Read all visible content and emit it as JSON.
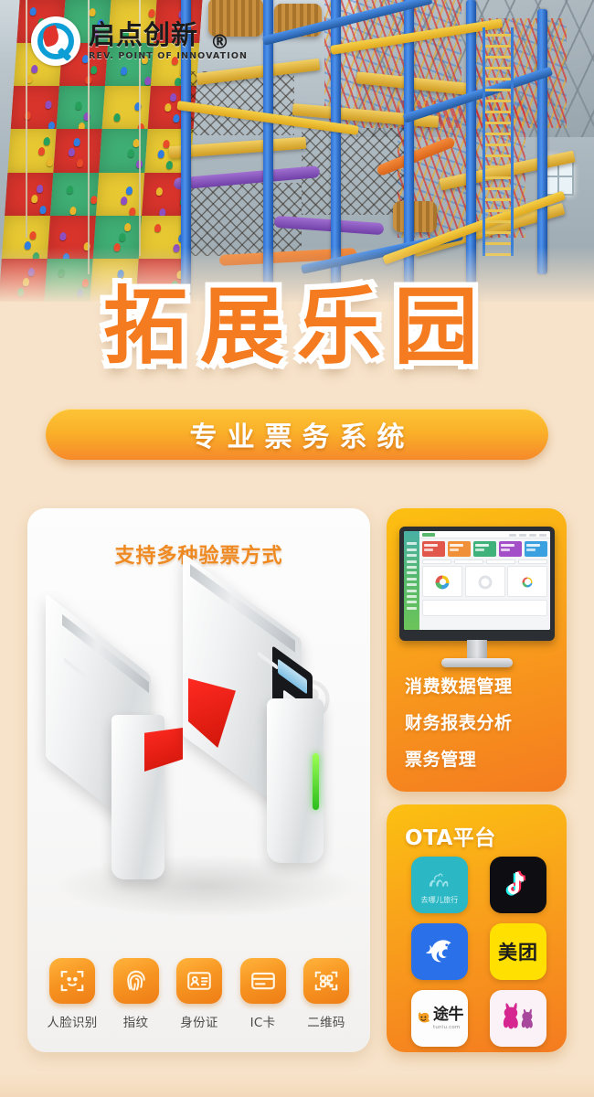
{
  "brand": {
    "logo_cn": "启点创新",
    "logo_en": "REV. POINT OF INNOVATION",
    "registered_mark": "®",
    "logo_icon": "q-circle-leaf-logo"
  },
  "hero": {
    "title": "拓展乐园",
    "subtitle": "专业票务系统",
    "photo_description": "indoor-adventure-park-photo"
  },
  "verification_card": {
    "title": "支持多种验票方式",
    "watermark": "®",
    "product_image": "speed-gate-turnstile-pair",
    "methods": [
      {
        "label": "人脸识别",
        "icon": "face-recognition-icon"
      },
      {
        "label": "指纹",
        "icon": "fingerprint-icon"
      },
      {
        "label": "身份证",
        "icon": "id-card-icon"
      },
      {
        "label": "IC卡",
        "icon": "ic-card-icon"
      },
      {
        "label": "二维码",
        "icon": "qr-code-icon"
      }
    ]
  },
  "management_card": {
    "device_image": "desktop-monitor-dashboard",
    "features": [
      "消费数据管理",
      "财务报表分析",
      "票务管理"
    ],
    "dashboard": {
      "tile_colors": [
        "#e2574c",
        "#f0913a",
        "#3fb27c",
        "#a350c8",
        "#3aa0e0"
      ]
    }
  },
  "ota_card": {
    "title": "OTA平台",
    "platforms": [
      {
        "name": "去哪儿旅行",
        "icon": "qunar-camel-icon",
        "color": "#2bb8c4"
      },
      {
        "name": "抖音",
        "icon": "douyin-note-icon",
        "color": "#0d0d12"
      },
      {
        "name": "携程",
        "icon": "ctrip-dolphin-icon",
        "color": "#2a70e8"
      },
      {
        "name": "美团",
        "icon": "meituan-icon",
        "color": "#ffe000"
      },
      {
        "name": "途牛",
        "icon": "tuniu-icon",
        "color": "#ffffff"
      },
      {
        "name": "同程艺龙",
        "icon": "rabbit-icon",
        "color": "#fbf2f7"
      }
    ],
    "tuniu_text": "途牛",
    "tuniu_url": "tuniu.com",
    "meituan_text": "美团"
  },
  "colors": {
    "background": "#f7e3ca",
    "accent_orange": "#f47b20",
    "accent_yellow": "#fcc011",
    "title_orange": "#f47b20",
    "flap_red": "#ff2a21",
    "led_green": "#3ecb2b"
  }
}
